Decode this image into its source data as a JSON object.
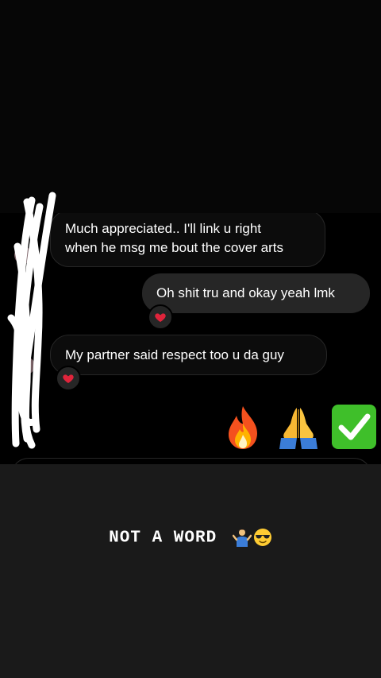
{
  "messages": [
    {
      "direction": "incoming",
      "text_line1": "Much appreciated.. I'll link u right",
      "text_line2": "when he msg me bout the cover arts"
    },
    {
      "direction": "outgoing",
      "text": "Oh shit tru and okay yeah lmk",
      "reaction": "heart-icon"
    },
    {
      "direction": "incoming",
      "text": "My partner said respect too u da guy",
      "reaction": "heart-icon"
    }
  ],
  "emoji_message": [
    "fire-emoji",
    "praying-hands-emoji",
    "check-mark-button-emoji"
  ],
  "caption": {
    "text": "NOT A WORD",
    "emojis": [
      "person-shrugging-emoji",
      "sunglasses-face-emoji"
    ]
  },
  "colors": {
    "incoming_bubble": "#0c0c0c",
    "outgoing_bubble": "#262626",
    "reaction_bg": "#262626",
    "story_bg": "#1a1a1a",
    "heart": "#e0243b",
    "check": "#3fbf2a"
  }
}
